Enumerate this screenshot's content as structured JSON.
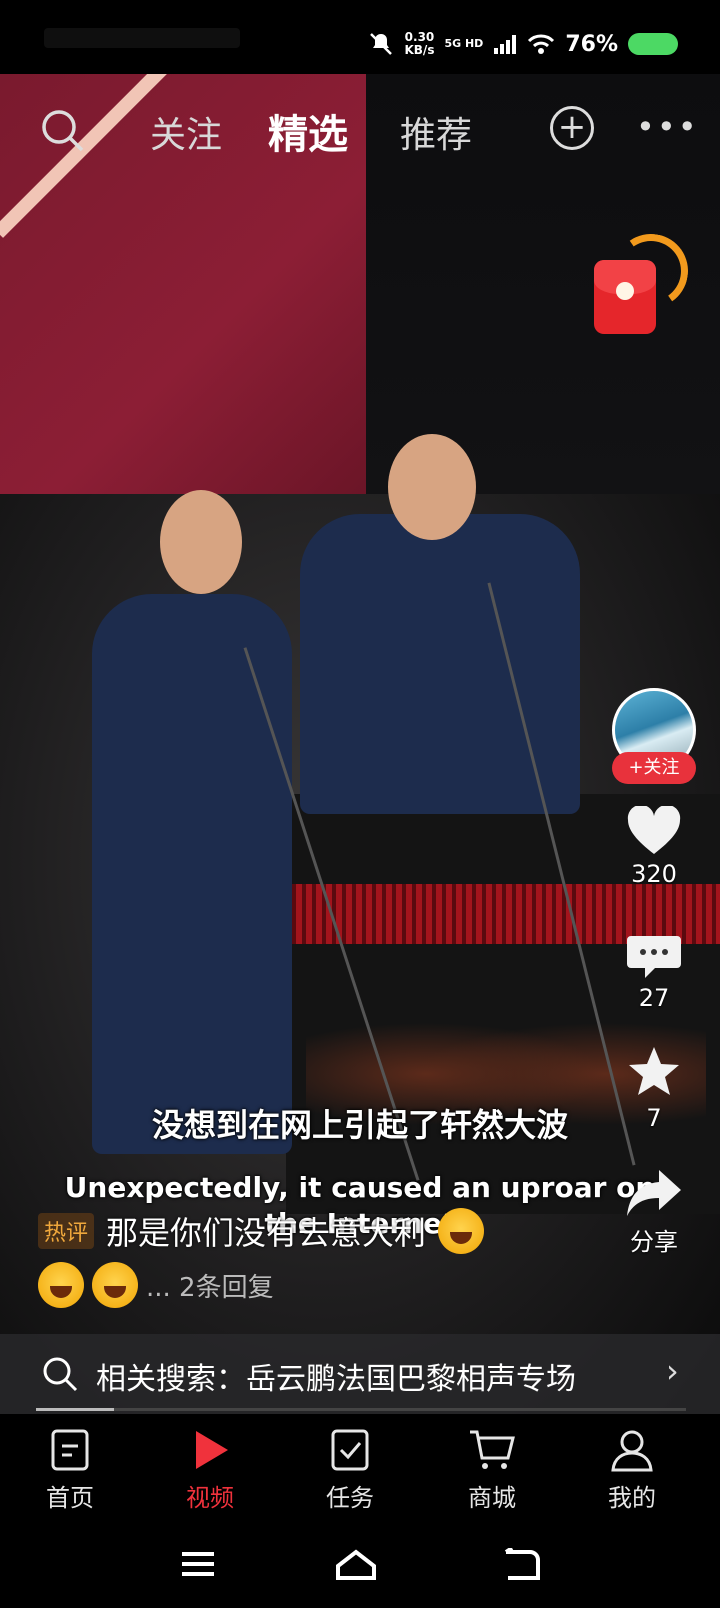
{
  "status_bar": {
    "net_speed_value": "0.30",
    "net_speed_unit": "KB/s",
    "network": "5G HD",
    "battery": "76%"
  },
  "top_nav": {
    "tabs": [
      {
        "label": "关注"
      },
      {
        "label": "精选"
      },
      {
        "label": "推荐"
      }
    ],
    "active_tab": "精选"
  },
  "right_rail": {
    "follow_label": "+关注",
    "likes": "320",
    "comments": "27",
    "favorites": "7",
    "share_label": "分享"
  },
  "subtitles": {
    "chinese": "没想到在网上引起了轩然大波",
    "english": "Unexpectedly, it caused an uproar on the Internet"
  },
  "hot_comment": {
    "badge": "热评",
    "text": "那是你们没有去意大利",
    "replies": "... 2条回复"
  },
  "related_search": {
    "label": "相关搜索：岳云鹏法国巴黎相声专场"
  },
  "bottom_nav": {
    "items": [
      {
        "label": "首页"
      },
      {
        "label": "视频"
      },
      {
        "label": "任务"
      },
      {
        "label": "商城"
      },
      {
        "label": "我的"
      }
    ],
    "active": "视频",
    "accent_color": "#f0323c"
  }
}
